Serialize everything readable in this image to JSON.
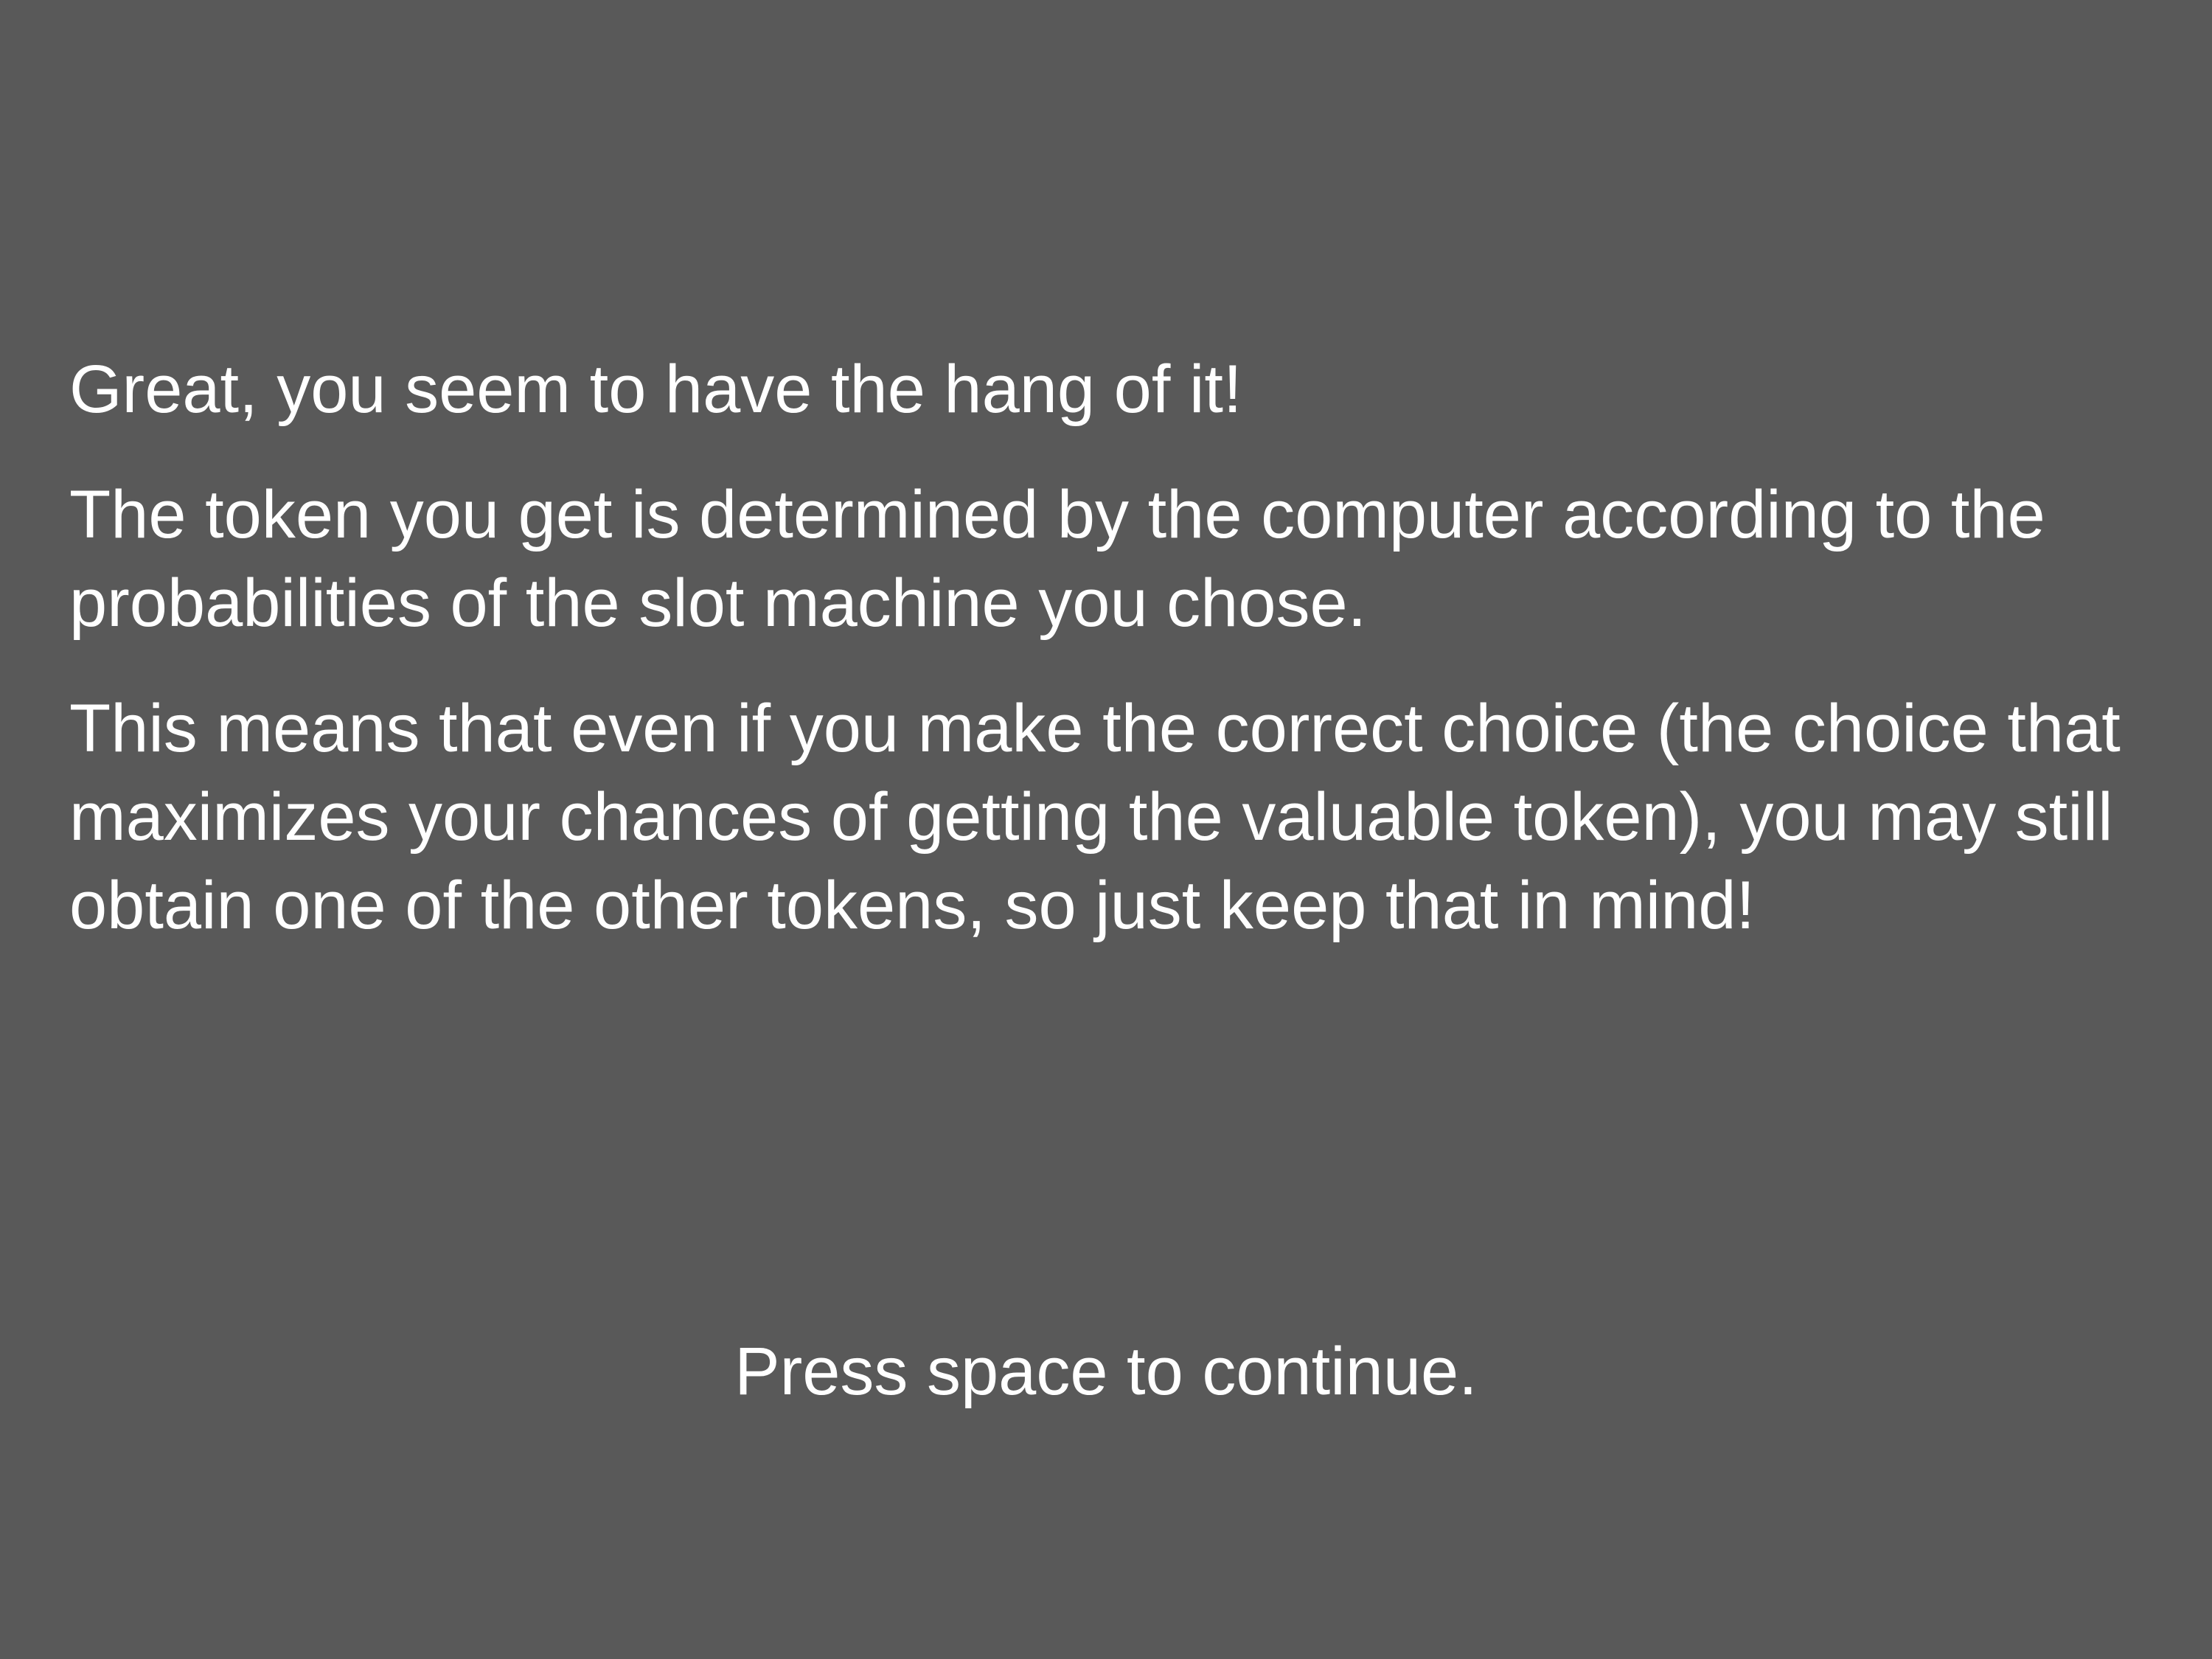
{
  "instructions": {
    "paragraphs": [
      "Great, you seem to have the hang of it!",
      "The token you get is determined by the computer according to the probabilities of the slot machine you chose.",
      "This means that even if you make the correct choice (the choice that maximizes your chances of getting the valuable token), you may still obtain one of the other tokens, so just keep that in mind!"
    ]
  },
  "prompt": {
    "continue_text": "Press space to continue."
  },
  "colors": {
    "background": "#595959",
    "text": "#ffffff"
  }
}
